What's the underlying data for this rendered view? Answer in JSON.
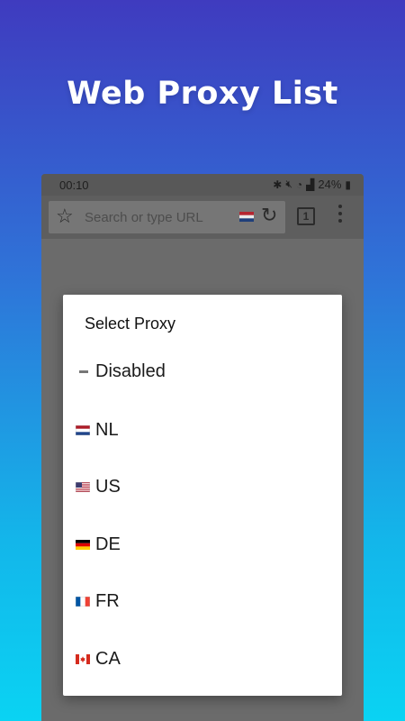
{
  "headline": "Web Proxy List",
  "status_bar": {
    "time": "00:10",
    "icons": [
      "bluetooth-icon",
      "mute-icon",
      "wifi-icon",
      "signal-icon",
      "battery-icon"
    ],
    "battery": "24%"
  },
  "browser": {
    "url_placeholder": "Search or type URL",
    "tab_count": "1",
    "current_proxy_flag": "NL"
  },
  "dialog": {
    "title": "Select Proxy",
    "items": [
      {
        "label": "Disabled",
        "icon": "disabled-dash-icon"
      },
      {
        "label": "NL",
        "icon": "netherlands-flag-icon"
      },
      {
        "label": "US",
        "icon": "us-flag-icon"
      },
      {
        "label": "DE",
        "icon": "germany-flag-icon"
      },
      {
        "label": "FR",
        "icon": "france-flag-icon"
      },
      {
        "label": "CA",
        "icon": "canada-flag-icon"
      }
    ]
  },
  "colors": {
    "gradient_top": "#3f3bbf",
    "gradient_bottom": "#0ad3f3",
    "overlay": "#6b6b6b",
    "dialog": "#ffffff"
  }
}
